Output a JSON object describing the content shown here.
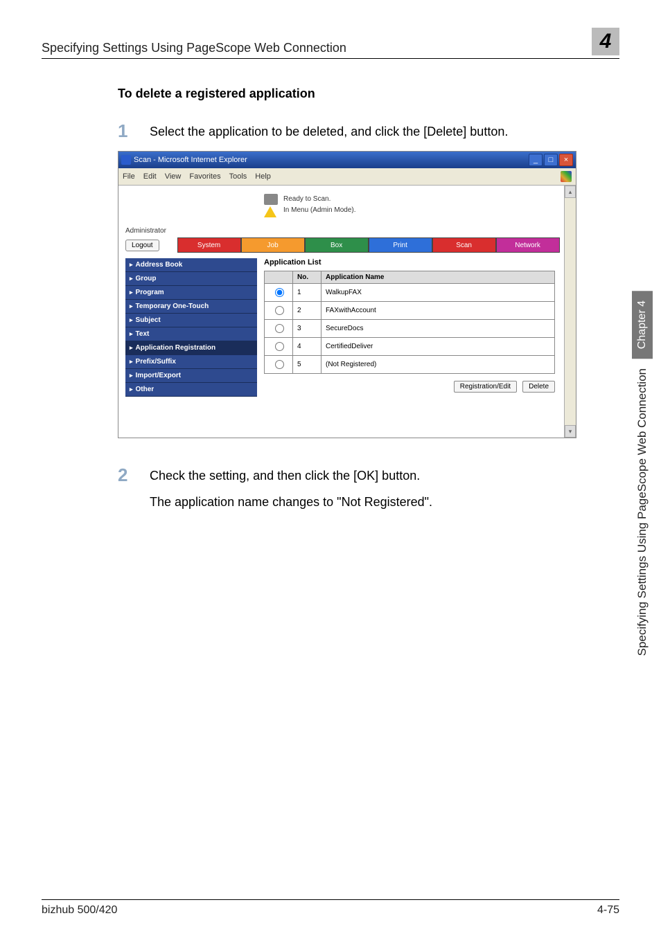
{
  "header": {
    "title": "Specifying Settings Using PageScope Web Connection",
    "section_number": "4"
  },
  "subheading": "To delete a registered application",
  "steps": [
    {
      "num": "1",
      "text": "Select the application to be deleted, and click the [Delete] button."
    },
    {
      "num": "2",
      "text": "Check the setting, and then click the [OK] button."
    }
  ],
  "step2_sub": "The application name changes to \"Not Registered\".",
  "window": {
    "title": "Scan - Microsoft Internet Explorer",
    "menus": [
      "File",
      "Edit",
      "View",
      "Favorites",
      "Tools",
      "Help"
    ],
    "status_line1": "Ready to Scan.",
    "status_line2": "In Menu (Admin Mode).",
    "admin_label": "Administrator",
    "logout": "Logout",
    "tabs": {
      "system": "System",
      "job": "Job",
      "box": "Box",
      "print": "Print",
      "scan": "Scan",
      "network": "Network"
    },
    "sidebar": [
      "Address Book",
      "Group",
      "Program",
      "Temporary One-Touch",
      "Subject",
      "Text",
      "Application Registration",
      "Prefix/Suffix",
      "Import/Export",
      "Other"
    ],
    "list_title": "Application List",
    "tbl_hdr_no": "No.",
    "tbl_hdr_name": "Application Name",
    "rows": [
      {
        "no": "1",
        "name": "WalkupFAX",
        "checked": true
      },
      {
        "no": "2",
        "name": "FAXwithAccount",
        "checked": false
      },
      {
        "no": "3",
        "name": "SecureDocs",
        "checked": false
      },
      {
        "no": "4",
        "name": "CertifiedDeliver",
        "checked": false
      },
      {
        "no": "5",
        "name": "(Not Registered)",
        "checked": false
      }
    ],
    "btn_regedit": "Registration/Edit",
    "btn_delete": "Delete"
  },
  "side_label": {
    "chapter": "Chapter 4",
    "text": "Specifying Settings Using PageScope Web Connection"
  },
  "footer": {
    "left": "bizhub 500/420",
    "right": "4-75"
  }
}
